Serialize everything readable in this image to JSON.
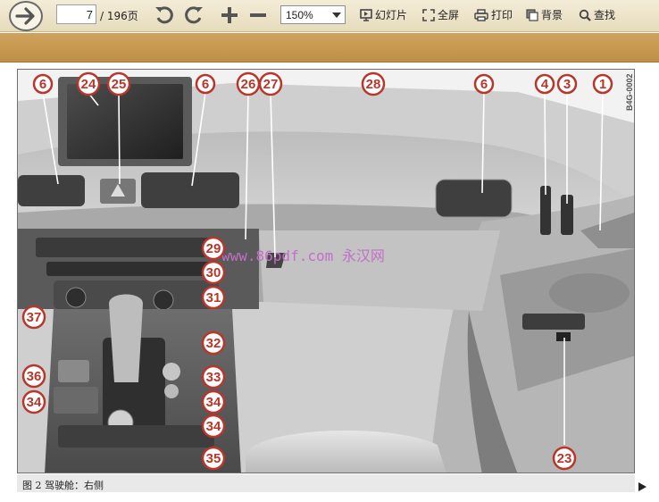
{
  "toolbar": {
    "page_value": "7",
    "page_total": "/ 196页",
    "zoom_value": "150%",
    "slideshow_label": "幻灯片",
    "fullscreen_label": "全屏",
    "print_label": "打印",
    "background_label": "背景",
    "find_label": "查找",
    "icons": {
      "next": "arrow-right-icon",
      "undo": "undo-icon",
      "redo": "redo-icon",
      "zoom_in": "plus-icon",
      "zoom_out": "minus-icon",
      "slideshow": "slideshow-icon",
      "fullscreen": "fullscreen-icon",
      "print": "printer-icon",
      "background": "background-icon",
      "find": "magnifier-icon"
    }
  },
  "figure": {
    "code": "B4G-0002",
    "watermark": "www.86pdf.com  永汉网",
    "callouts": [
      "1",
      "3",
      "4",
      "6",
      "6",
      "6",
      "23",
      "24",
      "25",
      "26",
      "27",
      "28",
      "29",
      "30",
      "31",
      "32",
      "33",
      "34",
      "34",
      "34",
      "35",
      "36",
      "37"
    ],
    "caption": "图 2  驾驶舱：右侧"
  },
  "colors": {
    "toolbar_bg": "#ece3c9",
    "band": "#c89a52",
    "callout_red": "#b7372c"
  }
}
